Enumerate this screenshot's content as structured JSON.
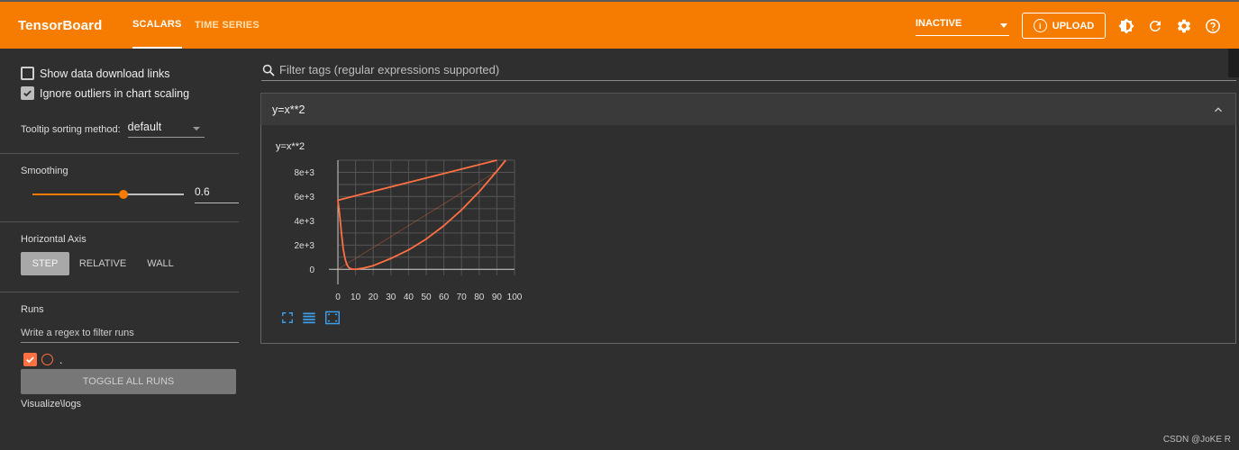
{
  "header": {
    "brand": "TensorBoard",
    "tabs": [
      {
        "label": "SCALARS",
        "active": true
      },
      {
        "label": "TIME SERIES",
        "active": false
      }
    ],
    "run_select": {
      "value": "INACTIVE"
    },
    "upload_label": "UPLOAD",
    "upload_icon": "info-icon",
    "icons": [
      "theme-toggle-icon",
      "refresh-icon",
      "settings-icon",
      "help-icon"
    ],
    "color": "#f57c00"
  },
  "sidebar": {
    "show_download_links": {
      "label": "Show data download links",
      "checked": false
    },
    "ignore_outliers": {
      "label": "Ignore outliers in chart scaling",
      "checked": true
    },
    "tooltip_sorting": {
      "label": "Tooltip sorting method:",
      "value": "default"
    },
    "smoothing": {
      "label": "Smoothing",
      "value": "0.6",
      "level": 0.6
    },
    "horizontal_axis": {
      "label": "Horizontal Axis",
      "options": [
        "STEP",
        "RELATIVE",
        "WALL"
      ],
      "selected": "STEP"
    },
    "runs": {
      "label": "Runs",
      "filter_placeholder": "Write a regex to filter runs",
      "items": [
        {
          "name": ".",
          "checked": true,
          "color": "#ff7043"
        }
      ],
      "toggle_all_label": "TOGGLE ALL RUNS",
      "logdir": "Visualize\\logs"
    }
  },
  "main": {
    "filter_placeholder": "Filter tags (regular expressions supported)",
    "group": {
      "title": "y=x**2"
    },
    "card": {
      "title": "y=x**2",
      "tools": [
        "fit-domain-icon",
        "toggle-log-scale-icon",
        "expand-icon"
      ]
    }
  },
  "chart_data": {
    "type": "line",
    "title": "y=x**2",
    "xlim": [
      0,
      100
    ],
    "ylim": [
      -500,
      9000
    ],
    "x_ticks": [
      "0",
      "10",
      "20",
      "30",
      "40",
      "50",
      "60",
      "70",
      "80",
      "90",
      "100"
    ],
    "y_ticks": [
      "0",
      "2e+3",
      "4e+3",
      "6e+3",
      "8e+3"
    ],
    "grid": true,
    "series": [
      {
        "color": "#ff7043",
        "x": [
          0,
          1,
          2,
          3,
          4,
          5,
          6,
          7,
          8,
          10,
          15,
          20,
          30,
          40,
          50,
          60,
          70,
          80,
          90,
          95
        ],
        "y": [
          5700,
          4500,
          3000,
          1700,
          900,
          420,
          180,
          70,
          20,
          0,
          120,
          300,
          900,
          1600,
          2500,
          3600,
          4900,
          6400,
          8100,
          9000
        ]
      },
      {
        "color": "#ff7043",
        "x": [
          0,
          90
        ],
        "y": [
          5700,
          9000
        ]
      }
    ],
    "raw_series": {
      "color": "#ff7043",
      "x": [
        0,
        90
      ],
      "y": [
        0,
        8100
      ]
    }
  },
  "footer": {
    "watermark": "CSDN @JoKE R"
  }
}
